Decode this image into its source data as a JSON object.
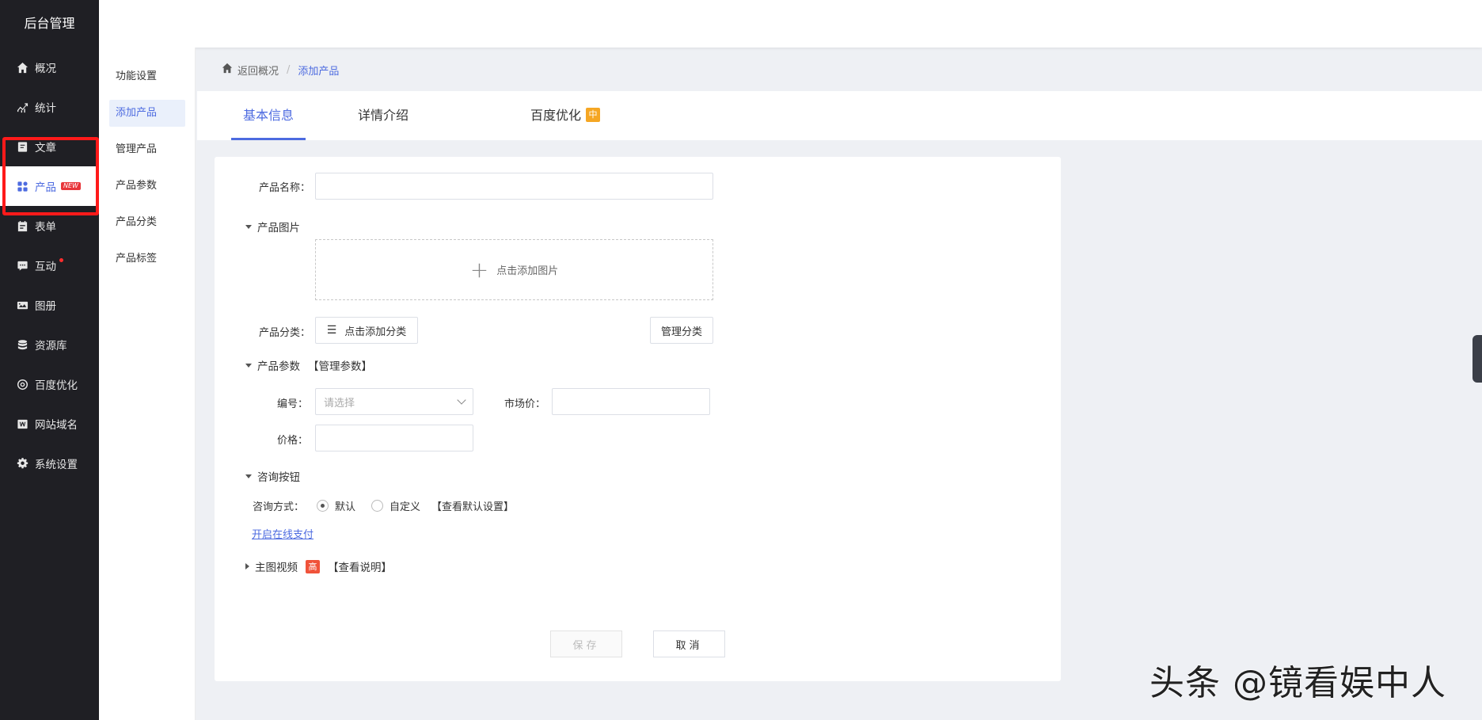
{
  "sidebar": {
    "brand": "后台管理",
    "items": [
      {
        "label": "概况",
        "icon": "home-icon"
      },
      {
        "label": "统计",
        "icon": "stats-icon"
      },
      {
        "label": "文章",
        "icon": "article-icon"
      },
      {
        "label": "产品",
        "icon": "product-icon",
        "badge": "NEW",
        "active": true
      },
      {
        "label": "表单",
        "icon": "form-icon"
      },
      {
        "label": "互动",
        "icon": "chat-icon",
        "dot": true
      },
      {
        "label": "图册",
        "icon": "album-icon"
      },
      {
        "label": "资源库",
        "icon": "database-icon"
      },
      {
        "label": "百度优化",
        "icon": "seo-icon"
      },
      {
        "label": "网站域名",
        "icon": "domain-icon"
      },
      {
        "label": "系统设置",
        "icon": "gear-icon"
      }
    ]
  },
  "submenu": {
    "items": [
      "功能设置",
      "添加产品",
      "管理产品",
      "产品参数",
      "产品分类",
      "产品标签"
    ],
    "active_index": 1
  },
  "breadcrumb": {
    "back": "返回概况",
    "separator": "/",
    "current": "添加产品"
  },
  "tabs": {
    "basic": "基本信息",
    "detail": "详情介绍",
    "seo": "百度优化",
    "seo_badge": "中"
  },
  "form": {
    "name_label": "产品名称：",
    "image_section": "产品图片",
    "upload_text": "点击添加图片",
    "category_label": "产品分类：",
    "add_category": "点击添加分类",
    "manage_category": "管理分类",
    "params_section": "产品参数",
    "manage_params": "【管理参数】",
    "code_label": "编号：",
    "code_placeholder": "请选择",
    "market_price_label": "市场价：",
    "price_label": "价格：",
    "consult_section": "咨询按钮",
    "consult_label": "咨询方式：",
    "radio_default": "默认",
    "radio_custom": "自定义",
    "view_default": "【查看默认设置】",
    "online_pay": "开启在线支付",
    "video_section": "主图视频",
    "video_badge": "高",
    "view_desc": "【查看说明】",
    "save": "保存",
    "cancel": "取消"
  },
  "watermark": "头条 @镜看娱中人",
  "colors": {
    "accent": "#4d6be0",
    "sidebar_bg": "#1f1f24",
    "highlight": "#ff1a1a",
    "badge_orange": "#f5a623",
    "badge_red": "#f0533a"
  }
}
